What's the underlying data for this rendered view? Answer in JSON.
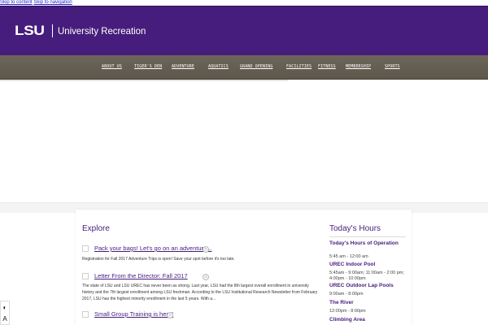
{
  "skip_links": {
    "content": "Skip to content",
    "navigation": "Skip to navigation"
  },
  "header": {
    "logo_mark": "LSU",
    "site_title": "University Recreation",
    "colors": {
      "brand_purple": "#461d7c",
      "nav_bar": "#655f53"
    }
  },
  "nav": {
    "items": [
      {
        "label": "ABOUT US"
      },
      {
        "label": "TIGER'S DEN"
      },
      {
        "label": "ADVENTURE"
      },
      {
        "label": "AQUATICS"
      },
      {
        "label": "GRAND OPENING"
      },
      {
        "label": "FACILITIES"
      },
      {
        "label": "FITNESS"
      },
      {
        "label": "MEMBERSHIP"
      },
      {
        "label": "SPORTS"
      }
    ]
  },
  "explore": {
    "heading": "Explore",
    "articles": [
      {
        "title": "Pack your bags! Let's go on an adventure...",
        "body": "Registration for Fall 2017 Adventure Trips is open! Save your spot before it's too late."
      },
      {
        "title": "Letter From the Director: Fall 2017",
        "body": "The state of LSU and LSU UREC has never been as strong.  Last year, LSU had the 8th largest overall enrollment in university history and the 7th largest enrollment among LSU freshman.  According to the LSU Institutional Research Newsletter from February 2017, LSU has the highest minority enrollment in the last 5 years.  With a..."
      },
      {
        "title": "Small Group Training is here!",
        "body": ""
      }
    ]
  },
  "hours": {
    "heading": "Today's Hours",
    "facilities": [
      {
        "name": "Today's Hours of Operation",
        "time": "5:45 am -   12:00 am"
      },
      {
        "name": "UREC Indoor Pool",
        "time": "5:45am - 9:00am; 11:00am - 2:00 pm;  4:00pm - 10:00pm"
      },
      {
        "name": "UREC Outdoor Lap Pools",
        "time": "9:00am - 8:00pm"
      },
      {
        "name": "The River",
        "time": "12:00pm - 8:00pm"
      },
      {
        "name": "Climbing Area",
        "time": ""
      }
    ]
  },
  "accessibility": {
    "contrast_icon": "contrast-icon",
    "text_size_icon": "text-size-icon"
  }
}
